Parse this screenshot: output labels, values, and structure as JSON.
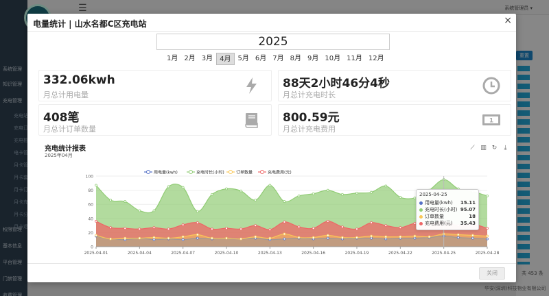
{
  "app": {
    "user_menu": "系统管理员 ▾",
    "reset_label": "重置",
    "total_text": "共 453 条",
    "company": "华安(深圳)科技物业有限公司",
    "sidebar_items": [
      "系统管理",
      "知识管理",
      "充电管理",
      "权限管理",
      "基本信息",
      "平台管理",
      "门禁管理",
      "收费管理"
    ],
    "sidebar_sub_items": [
      "充电站管理",
      "充电订单",
      "充电桩管理",
      "电卡管理",
      "月卡管理",
      "月卡套餐",
      "月卡订单",
      "月卡充值",
      "月卡分配",
      "月卡退款"
    ]
  },
  "modal": {
    "title": "电量统计 | 山水名都C区充电站",
    "close_icon": "×",
    "year": "2025",
    "months": [
      "1月",
      "2月",
      "3月",
      "4月",
      "5月",
      "6月",
      "7月",
      "8月",
      "9月",
      "10月",
      "11月",
      "12月"
    ],
    "active_month": "4月",
    "stats": [
      {
        "value": "332.06kwh",
        "label": "月总计用电量",
        "icon": "lightning-icon"
      },
      {
        "value": "88天2小时46分4秒",
        "label": "月总计充电时长",
        "icon": "clock-icon"
      },
      {
        "value": "408笔",
        "label": "月总计订单数量",
        "icon": "book-icon"
      },
      {
        "value": "800.59元",
        "label": "月总计充电费用",
        "icon": "money-icon"
      }
    ],
    "footer_close": "关闭"
  },
  "chart_data": {
    "type": "area",
    "title": "充电统计报表",
    "subtitle": "2025年04月",
    "ylim": [
      0,
      100
    ],
    "yticks": [
      0,
      20,
      40,
      60,
      80,
      100
    ],
    "x": [
      "2025-04-01",
      "2025-04-02",
      "2025-04-03",
      "2025-04-04",
      "2025-04-05",
      "2025-04-06",
      "2025-04-07",
      "2025-04-08",
      "2025-04-09",
      "2025-04-10",
      "2025-04-11",
      "2025-04-12",
      "2025-04-13",
      "2025-04-14",
      "2025-04-15",
      "2025-04-16",
      "2025-04-17",
      "2025-04-18",
      "2025-04-19",
      "2025-04-20",
      "2025-04-21",
      "2025-04-22",
      "2025-04-23",
      "2025-04-24",
      "2025-04-25",
      "2025-04-26",
      "2025-04-27",
      "2025-04-28"
    ],
    "x_tick_labels": [
      "2025-04-01",
      "2025-04-04",
      "2025-04-07",
      "2025-04-10",
      "2025-04-13",
      "2025-04-16",
      "2025-04-19",
      "2025-04-22",
      "2025-04-25",
      "2025-04-28"
    ],
    "series": [
      {
        "name": "用电量(kwh)",
        "color": "#5470c6",
        "values": [
          15,
          11,
          10,
          12,
          10,
          11,
          10,
          12,
          11,
          12,
          11,
          12,
          10,
          11,
          12,
          11,
          12,
          11,
          12,
          12,
          11,
          12,
          12,
          13,
          15.11,
          13,
          12,
          11
        ]
      },
      {
        "name": "充电时长(小时)",
        "color": "#91cc75",
        "values": [
          87,
          66,
          64,
          51,
          51,
          85,
          84,
          50,
          74,
          82,
          79,
          66,
          87,
          64,
          72,
          75,
          80,
          74,
          76,
          77,
          86,
          70,
          69,
          80,
          95.07,
          82,
          78,
          72
        ]
      },
      {
        "name": "订单数量",
        "color": "#fac858",
        "values": [
          16,
          11,
          12,
          12,
          13,
          12,
          14,
          17,
          12,
          12,
          11,
          14,
          12,
          18,
          13,
          13,
          16,
          13,
          13,
          15,
          14,
          14,
          15,
          14,
          18,
          17,
          16,
          15
        ]
      },
      {
        "name": "充电费用(元)",
        "color": "#ee6666",
        "values": [
          36,
          27,
          26,
          25,
          27,
          25,
          31,
          34,
          25,
          26,
          25,
          30,
          24,
          35,
          28,
          26,
          36,
          28,
          25,
          34,
          30,
          27,
          33,
          33,
          35.43,
          30,
          32,
          26
        ]
      }
    ],
    "tooltip": {
      "date": "2025-04-25",
      "rows": [
        {
          "name": "用电量(kwh)",
          "value": "15.11",
          "color": "#5470c6"
        },
        {
          "name": "充电时长(小时)",
          "value": "95.07",
          "color": "#91cc75"
        },
        {
          "name": "订单数量",
          "value": "18",
          "color": "#fac858"
        },
        {
          "name": "充电费用(元)",
          "value": "35.43",
          "color": "#ee6666"
        }
      ]
    }
  }
}
